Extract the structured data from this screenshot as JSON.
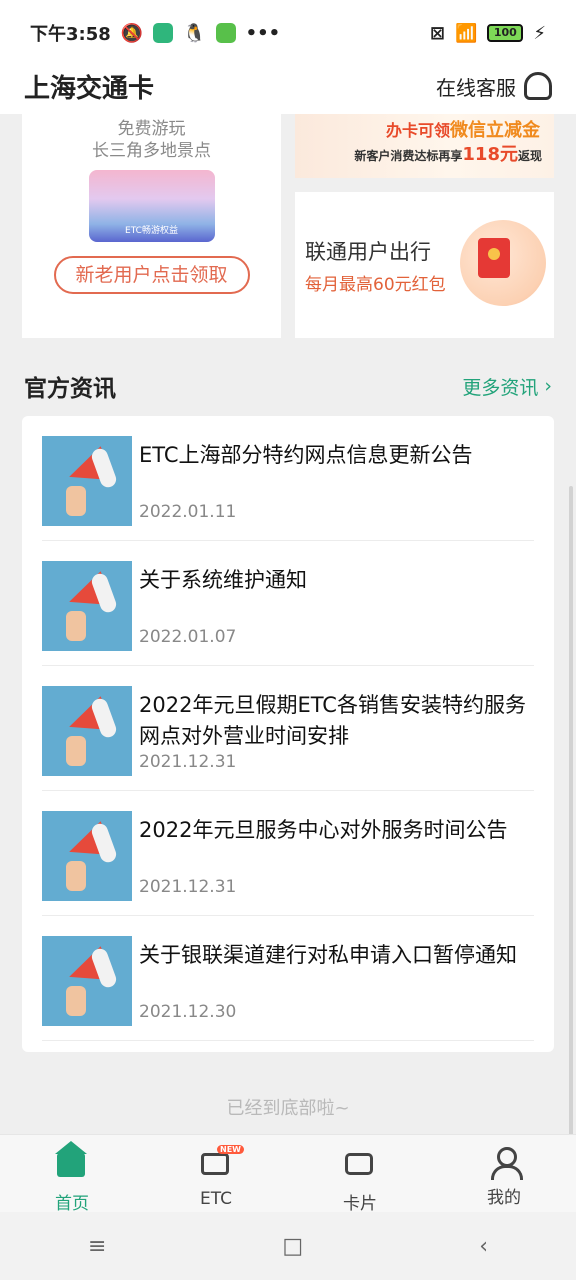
{
  "status_bar": {
    "time": "下午3:58",
    "more": "•••",
    "battery": "100"
  },
  "header": {
    "title": "上海交通卡",
    "service_label": "在线客服"
  },
  "promos": {
    "left": {
      "line1": "免费游玩",
      "line2": "长三角多地景点",
      "image_caption": "ETC畅游权益",
      "button": "新老用户点击领取"
    },
    "right_top": {
      "line1_prefix": "办卡可领",
      "line1_highlight": "微信立减金",
      "line2_prefix": "新客户消费达标再享",
      "line2_amount": "118元",
      "line2_suffix": "返现"
    },
    "right_bottom": {
      "title": "联通用户出行",
      "subtitle": "每月最高60元红包"
    }
  },
  "news": {
    "heading": "官方资讯",
    "more_label": "更多资讯",
    "items": [
      {
        "title": "ETC上海部分特约网点信息更新公告",
        "date": "2022.01.11"
      },
      {
        "title": "关于系统维护通知",
        "date": "2022.01.07"
      },
      {
        "title": "2022年元旦假期ETC各销售安装特约服务网点对外营业时间安排",
        "date": "2021.12.31"
      },
      {
        "title": "2022年元旦服务中心对外服务时间公告",
        "date": "2021.12.31"
      },
      {
        "title": "关于银联渠道建行对私申请入口暂停通知",
        "date": "2021.12.30"
      }
    ]
  },
  "end_tip": "已经到底部啦~",
  "tabbar": {
    "items": [
      {
        "label": "首页",
        "icon": "home-icon",
        "active": true
      },
      {
        "label": "ETC",
        "icon": "etc-icon",
        "badge": "NEW"
      },
      {
        "label": "卡片",
        "icon": "wallet-icon"
      },
      {
        "label": "我的",
        "icon": "user-icon"
      }
    ]
  },
  "system_nav": {
    "menu": "≡",
    "home": "□",
    "back": "‹"
  },
  "colors": {
    "accent": "#22a37a",
    "promo_red": "#e26a50",
    "background": "#efefef"
  }
}
